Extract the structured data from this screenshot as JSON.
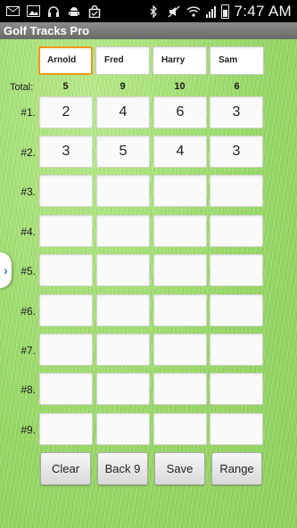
{
  "status_bar": {
    "time": "7:47 AM",
    "left_icons": [
      "envelope-icon",
      "image-icon",
      "headset-icon",
      "robot-icon",
      "bag-icon"
    ],
    "right_icons": [
      "bluetooth-icon",
      "mute-icon",
      "wifi-icon",
      "signal-icon",
      "battery-icon"
    ]
  },
  "app": {
    "title": "Golf Tracks Pro"
  },
  "players": [
    "Arnold",
    "Fred",
    "Harry",
    "Sam"
  ],
  "totals": {
    "label": "Total:",
    "values": [
      "5",
      "9",
      "10",
      "6"
    ]
  },
  "holes": [
    {
      "label": "#1.",
      "scores": [
        "2",
        "4",
        "6",
        "3"
      ]
    },
    {
      "label": "#2.",
      "scores": [
        "3",
        "5",
        "4",
        "3"
      ]
    },
    {
      "label": "#3.",
      "scores": [
        "",
        "",
        "",
        ""
      ]
    },
    {
      "label": "#4.",
      "scores": [
        "",
        "",
        "",
        ""
      ]
    },
    {
      "label": "#5.",
      "scores": [
        "",
        "",
        "",
        ""
      ]
    },
    {
      "label": "#6.",
      "scores": [
        "",
        "",
        "",
        ""
      ]
    },
    {
      "label": "#7.",
      "scores": [
        "",
        "",
        "",
        ""
      ]
    },
    {
      "label": "#8.",
      "scores": [
        "",
        "",
        "",
        ""
      ]
    },
    {
      "label": "#9.",
      "scores": [
        "",
        "",
        "",
        ""
      ]
    }
  ],
  "buttons": {
    "clear": "Clear",
    "back9": "Back 9",
    "save": "Save",
    "range": "Range"
  },
  "drawer": {
    "icon": "chevron-right-icon",
    "glyph": "›"
  },
  "colors": {
    "focus": "#f29a1d",
    "background": "#9fdc6e",
    "title_bar": "#7a7a7a"
  }
}
